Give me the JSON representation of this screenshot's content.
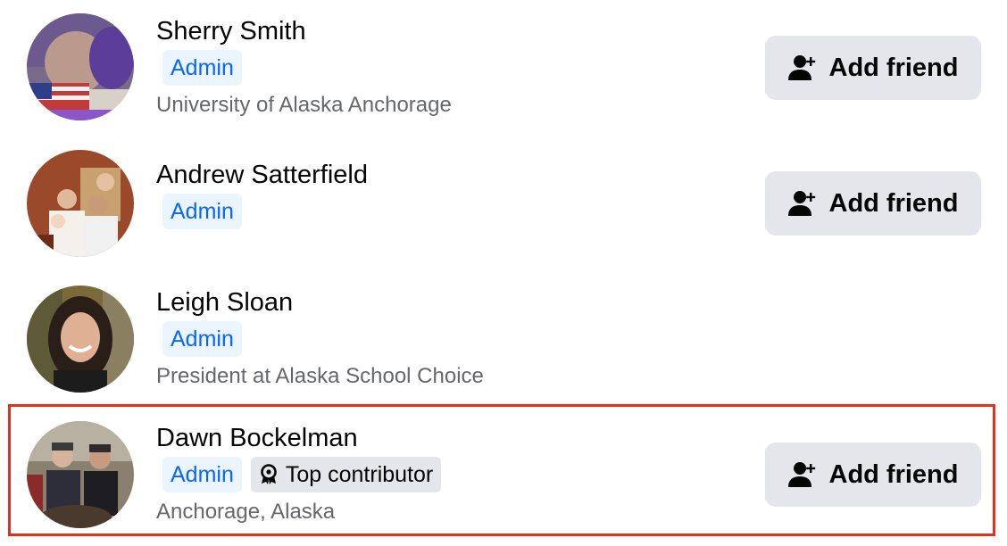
{
  "members": [
    {
      "name": "Sherry Smith",
      "badges": [
        "Admin"
      ],
      "subtitle": "University of Alaska Anchorage",
      "action_label": "Add friend"
    },
    {
      "name": "Andrew Satterfield",
      "badges": [
        "Admin"
      ],
      "subtitle": "",
      "action_label": "Add friend"
    },
    {
      "name": "Leigh Sloan",
      "badges": [
        "Admin"
      ],
      "subtitle": "President at Alaska School Choice",
      "action_label": ""
    },
    {
      "name": "Dawn Bockelman",
      "badges": [
        "Admin",
        "Top contributor"
      ],
      "subtitle": "Anchorage, Alaska",
      "action_label": "Add friend"
    }
  ],
  "icons": {
    "add_friend": "add-friend-icon",
    "top_contributor": "award-icon"
  },
  "colors": {
    "admin_badge_text": "#0866ff",
    "admin_badge_bg": "#ebf5ff",
    "button_bg": "#e4e6eb",
    "highlight_border": "#e0301e"
  }
}
